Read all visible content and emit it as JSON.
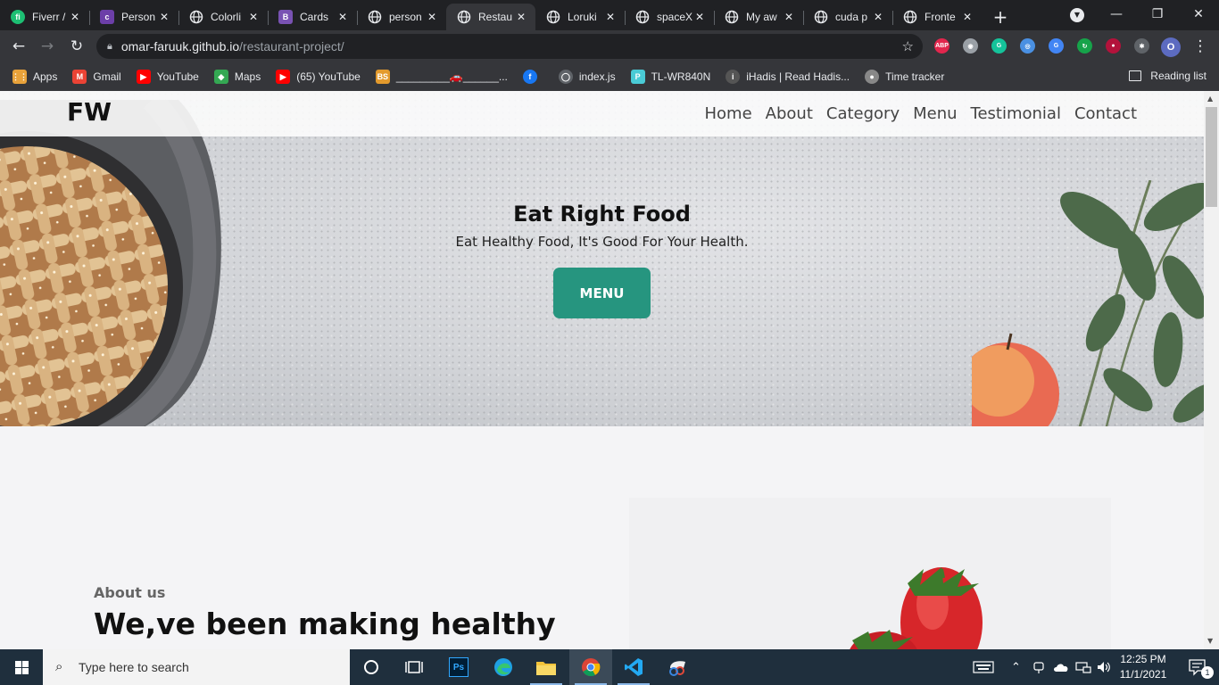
{
  "browser": {
    "tabs": [
      {
        "label": "Fiverr /",
        "icon": "fiverr-icon",
        "color": "#1dbf73",
        "glyph": "fi"
      },
      {
        "label": "Person",
        "icon": "colorlib-icon",
        "color": "#6c3fa8",
        "glyph": "c"
      },
      {
        "label": "Colorli",
        "icon": "globe-icon",
        "color": "#e8eaed",
        "glyph": ""
      },
      {
        "label": "Cards",
        "icon": "bootstrap-icon",
        "color": "#7952b3",
        "glyph": "B"
      },
      {
        "label": "person",
        "icon": "globe-icon",
        "color": "#e8eaed",
        "glyph": ""
      },
      {
        "label": "Restau",
        "icon": "globe-icon",
        "color": "#e8eaed",
        "glyph": "",
        "active": true
      },
      {
        "label": "Loruki",
        "icon": "globe-icon",
        "color": "#e8eaed",
        "glyph": ""
      },
      {
        "label": "spaceX",
        "icon": "globe-icon",
        "color": "#e8eaed",
        "glyph": ""
      },
      {
        "label": "My aw",
        "icon": "globe-icon",
        "color": "#e8eaed",
        "glyph": ""
      },
      {
        "label": "cuda p",
        "icon": "globe-icon",
        "color": "#e8eaed",
        "glyph": ""
      },
      {
        "label": "Fronte",
        "icon": "globe-icon",
        "color": "#e8eaed",
        "glyph": ""
      }
    ],
    "url_host": "omar-faruuk.github.io",
    "url_path": "/restaurant-project/",
    "profile_initial": "O",
    "extensions": [
      {
        "name": "adblock-plus-icon",
        "glyph": "ABP",
        "color": "#e2264d"
      },
      {
        "name": "camera-icon",
        "glyph": "◉",
        "color": "#9aa0a6"
      },
      {
        "name": "grammarly-icon",
        "glyph": "G",
        "color": "#15c39a"
      },
      {
        "name": "color-picker-icon",
        "glyph": "◎",
        "color": "#4a90e2"
      },
      {
        "name": "google-translate-icon",
        "glyph": "G",
        "color": "#4285f4"
      },
      {
        "name": "sync-icon",
        "glyph": "↻",
        "color": "#16a34a"
      },
      {
        "name": "recorder-icon",
        "glyph": "●",
        "color": "#b3123b"
      },
      {
        "name": "extensions-puzzle-icon",
        "glyph": "✱",
        "color": "#5f6368"
      }
    ],
    "bookmarks": [
      {
        "label": "Apps",
        "icon": "apps-grid-icon",
        "color": "#e8a23a",
        "glyph": "⋮⋮"
      },
      {
        "label": "Gmail",
        "icon": "gmail-icon",
        "color": "#ea4335",
        "glyph": "M"
      },
      {
        "label": "YouTube",
        "icon": "youtube-icon",
        "color": "#ff0000",
        "glyph": "▶"
      },
      {
        "label": "Maps",
        "icon": "maps-icon",
        "color": "#34a853",
        "glyph": "◆"
      },
      {
        "label": "(65) YouTube",
        "icon": "youtube-icon",
        "color": "#ff0000",
        "glyph": "▶"
      },
      {
        "label": "_________🚗______...",
        "icon": "bs-icon",
        "color": "#e39a2d",
        "glyph": "BS"
      },
      {
        "label": "",
        "icon": "facebook-icon",
        "color": "#1877f2",
        "glyph": "f"
      },
      {
        "label": "index.js",
        "icon": "globe-icon",
        "color": "#5f6368",
        "glyph": "◯"
      },
      {
        "label": "TL-WR840N",
        "icon": "tplink-icon",
        "color": "#4acbd6",
        "glyph": "P"
      },
      {
        "label": "iHadis | Read Hadis...",
        "icon": "ihadis-icon",
        "color": "#555",
        "glyph": "i"
      },
      {
        "label": "Time tracker",
        "icon": "time-tracker-icon",
        "color": "#888",
        "glyph": "●"
      }
    ],
    "reading_list": "Reading list"
  },
  "site": {
    "logo": "FW",
    "nav": [
      "Home",
      "About",
      "Category",
      "Menu",
      "Testimonial",
      "Contact"
    ],
    "hero": {
      "title": "Eat Right Food",
      "subtitle": "Eat Healthy Food, It's Good For Your Health.",
      "button": "MENU",
      "button_color": "#26957f"
    },
    "about": {
      "label": "About us",
      "heading": "We,ve been making healthy"
    }
  },
  "taskbar": {
    "search_placeholder": "Type here to search",
    "time": "12:25 PM",
    "date": "11/1/2021",
    "notification_count": "1"
  }
}
